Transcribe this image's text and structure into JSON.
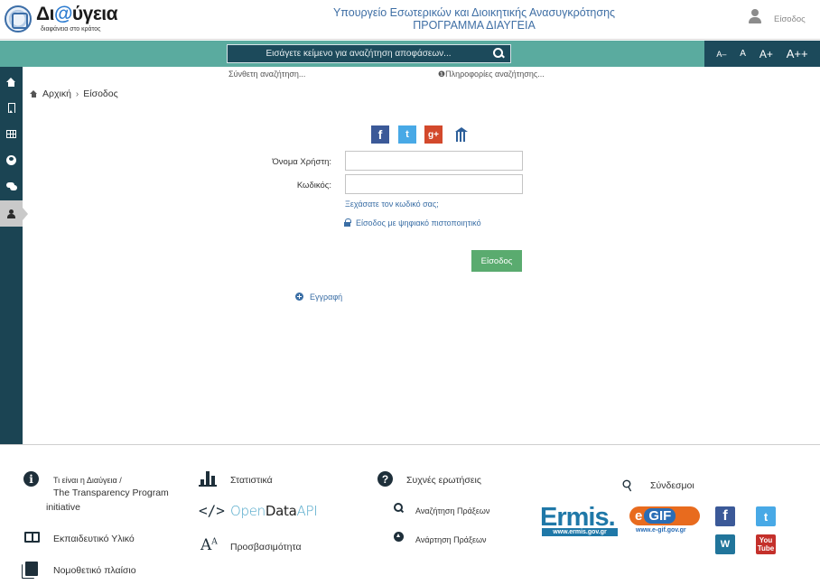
{
  "header": {
    "logo_title_prefix": "Δι",
    "logo_title_at": "@",
    "logo_title_suffix": "ύγεια",
    "logo_subtitle": "διαφάνεια στο κράτος",
    "ministry_line1": "Υπουργείο Εσωτερικών και Διοικητικής Ανασυγκρότησης",
    "ministry_line2": "ΠΡΟΓΡΑΜΜΑ ΔΙΑΥΓΕΙΑ",
    "login_label": "Είσοδος"
  },
  "search": {
    "placeholder": "Εισάγετε κείμενο για αναζήτηση αποφάσεων...",
    "compose_label": "Σύνθετη αναζήτηση...",
    "info_label": "Πληροφορίες αναζήτησης..."
  },
  "font_size_controls": [
    "A–",
    "A",
    "A+",
    "A++"
  ],
  "sidebar": {
    "items": [
      {
        "icon": "home-icon"
      },
      {
        "icon": "bookmark-icon"
      },
      {
        "icon": "table-icon"
      },
      {
        "icon": "globe-icon"
      },
      {
        "icon": "chat-icon"
      },
      {
        "icon": "user-icon",
        "active": true
      }
    ]
  },
  "breadcrumb": {
    "home": "Αρχική",
    "separator": "›",
    "current": "Είσοδος"
  },
  "share": {
    "facebook": "f",
    "twitter": "t",
    "googleplus": "g+"
  },
  "login_form": {
    "username_label": "Όνομα Χρήστη:",
    "username_value": "",
    "password_label": "Κωδικός:",
    "password_value": "",
    "forgot_password": "Ξεχάσατε τον κωδικό σας;",
    "certificate_login": "Είσοδος με ψηφιακό πιστοποιητικό",
    "submit_label": "Είσοδος",
    "register_label": "Εγγραφή"
  },
  "footer": {
    "about_line1": "Τι είναι η Διαύγεια /",
    "about_line2": "The Transparency Program",
    "about_line3": "initiative",
    "training": "Εκπαιδευτικό Υλικό",
    "legal": "Νομοθετικό πλαίσιο",
    "statistics": "Στατιστικά",
    "opendata_open": "Open",
    "opendata_data": "Data",
    "opendata_api": "API",
    "accessibility": "Προσβασιμότητα",
    "faq": "Συχνές ερωτήσεις",
    "search_acts": "Αναζήτηση Πράξεων",
    "upload_acts": "Ανάρτηση Πράξεων",
    "links": "Σύνδεσμοι",
    "ermis_logo": "Ermis.",
    "ermis_url": "www.ermis.gov.gr",
    "egif_logo_e": "e",
    "egif_logo_gif": "GIF",
    "egif_url": "www.e-gif.gov.gr",
    "facebook": "f",
    "twitter": "t",
    "wordpress": "W",
    "youtube_top": "You",
    "youtube_bottom": "Tube"
  },
  "colors": {
    "search_bar": "#5aab9f",
    "dark_teal": "#1b4453",
    "submit_green": "#5aab6f",
    "link_blue": "#3a6ea5"
  }
}
